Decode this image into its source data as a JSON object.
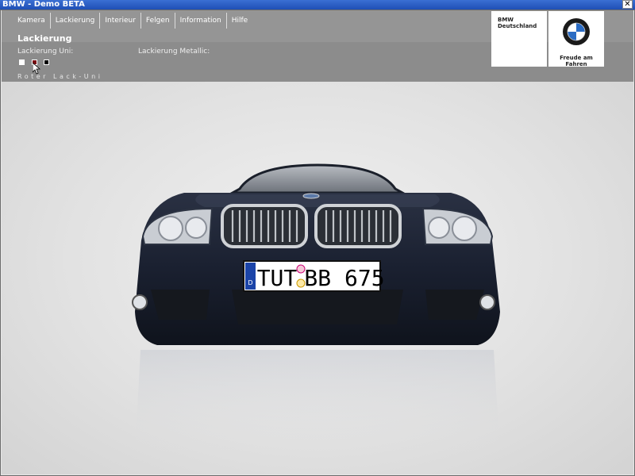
{
  "window": {
    "title": "BMW - Demo BETA",
    "close_glyph": "✕"
  },
  "nav": {
    "items": [
      {
        "label": "Kamera"
      },
      {
        "label": "Lackierung"
      },
      {
        "label": "Interieur"
      },
      {
        "label": "Felgen"
      },
      {
        "label": "Information"
      },
      {
        "label": "Hilfe"
      }
    ]
  },
  "panel": {
    "title": "Lackierung",
    "uni_label": "Lackierung Uni:",
    "metallic_label": "Lackierung Metallic:",
    "swatches": [
      {
        "name": "white",
        "color": "#ffffff"
      },
      {
        "name": "red",
        "color": "#7a0c12"
      },
      {
        "name": "black",
        "color": "#000000"
      }
    ],
    "selected_name": "Roter Lack-Uni"
  },
  "brand": {
    "company_line1": "BMW",
    "company_line2": "Deutschland",
    "slogan": "Freude am Fahren",
    "logo_letters": "BMW"
  },
  "car": {
    "plate_country": "D",
    "plate_left": "TUT",
    "plate_right": "BB 675",
    "paint_color": "#1c2230"
  },
  "icons": [
    "close-icon",
    "bmw-roundel-icon",
    "mouse-cursor-icon"
  ]
}
